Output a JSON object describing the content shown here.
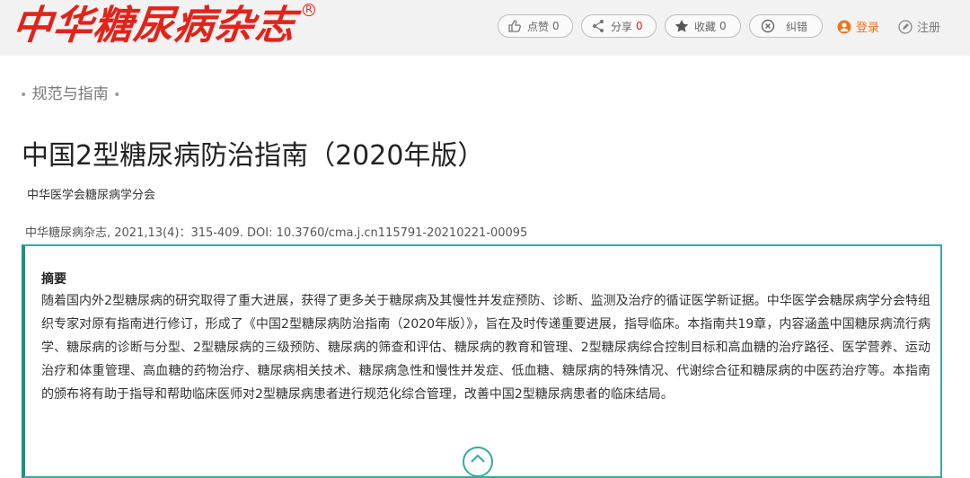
{
  "header": {
    "logo": "中华糖尿病杂志",
    "logo_mark": "R",
    "actions": [
      {
        "label": "点赞",
        "count": "0",
        "icon": "thumbs-up-icon"
      },
      {
        "label": "分享",
        "count": "0",
        "icon": "share-icon"
      },
      {
        "label": "收藏",
        "count": "0",
        "icon": "star-icon"
      },
      {
        "label": "纠错",
        "icon": "error-report-icon"
      }
    ],
    "login": "登录",
    "register": "注册"
  },
  "section": {
    "label": "规范与指南",
    "bullet": "•"
  },
  "article": {
    "title": "中国2型糖尿病防治指南（2020年版）",
    "author": "中华医学会糖尿病学分会",
    "citation": "中华糖尿病杂志, 2021,13(4)：315-409. DOI: 10.3760/cma.j.cn115791-20210221-00095"
  },
  "abstract": {
    "heading": "摘要",
    "text": "随着国内外2型糖尿病的研究取得了重大进展，获得了更多关于糖尿病及其慢性并发症预防、诊断、监测及治疗的循证医学新证据。中华医学会糖尿病学分会特组织专家对原有指南进行修订，形成了《中国2型糖尿病防治指南（2020年版）》，旨在及时传递重要进展，指导临床。本指南共19章，内容涵盖中国糖尿病流行病学、糖尿病的诊断与分型、2型糖尿病的三级预防、糖尿病的筛查和评估、糖尿病的教育和管理、2型糖尿病综合控制目标和高血糖的治疗路径、医学营养、运动治疗和体重管理、高血糖的药物治疗、糖尿病相关技术、糖尿病急性和慢性并发症、低血糖、糖尿病的特殊情况、代谢综合征和糖尿病的中医药治疗等。本指南的颁布将有助于指导和帮助临床医师对2型糖尿病患者进行规范化综合管理，改善中国2型糖尿病患者的临床结局。"
  },
  "colors": {
    "brand_red": "#e2231a",
    "accent_teal": "#3aa9a0",
    "login_orange": "#e87722"
  }
}
